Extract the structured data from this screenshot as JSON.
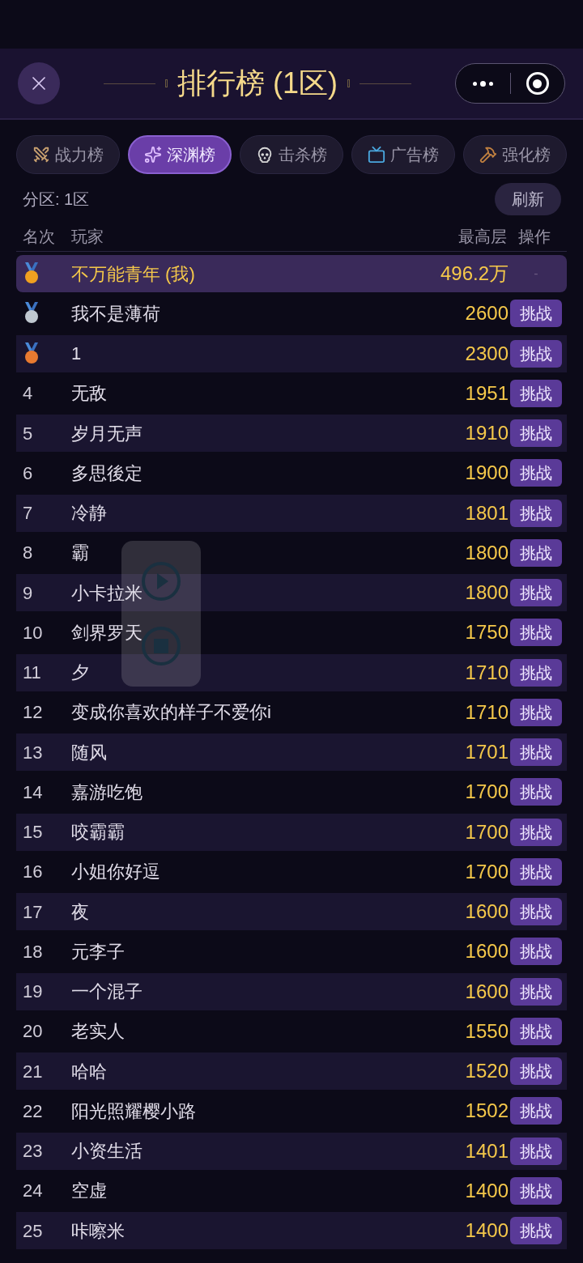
{
  "header": {
    "title": "排行榜 (1区)"
  },
  "tabs": [
    {
      "label": "战力榜",
      "selected": false
    },
    {
      "label": "深渊榜",
      "selected": true
    },
    {
      "label": "击杀榜",
      "selected": false
    },
    {
      "label": "广告榜",
      "selected": false
    },
    {
      "label": "强化榜",
      "selected": false
    }
  ],
  "zone_label": "分区: 1区",
  "refresh_button": "刷新",
  "columns": [
    "名次",
    "玩家",
    "最高层",
    "操作"
  ],
  "rows": [
    {
      "kind": "medal",
      "color": "#f0a020",
      "name": "不万能青年 (我)",
      "score": "496.2万",
      "self": true,
      "action": "-"
    },
    {
      "kind": "medal",
      "color": "#c0c8d0",
      "name": "我不是薄荷",
      "score": "2600",
      "self": false,
      "action": "挑战"
    },
    {
      "kind": "medal",
      "color": "#e87a30",
      "name": "1",
      "score": "2300",
      "self": false,
      "action": "挑战"
    },
    {
      "kind": "number",
      "rank": "4",
      "name": "无敌",
      "score": "1951",
      "self": false,
      "action": "挑战"
    },
    {
      "kind": "number",
      "rank": "5",
      "name": "岁月无声",
      "score": "1910",
      "self": false,
      "action": "挑战"
    },
    {
      "kind": "number",
      "rank": "6",
      "name": "多思後定",
      "score": "1900",
      "self": false,
      "action": "挑战"
    },
    {
      "kind": "number",
      "rank": "7",
      "name": "冷静",
      "score": "1801",
      "self": false,
      "action": "挑战"
    },
    {
      "kind": "number",
      "rank": "8",
      "name": "霸",
      "score": "1800",
      "self": false,
      "action": "挑战"
    },
    {
      "kind": "number",
      "rank": "9",
      "name": "小卡拉米",
      "score": "1800",
      "self": false,
      "action": "挑战"
    },
    {
      "kind": "number",
      "rank": "10",
      "name": "剑界罗天",
      "score": "1750",
      "self": false,
      "action": "挑战"
    },
    {
      "kind": "number",
      "rank": "11",
      "name": "夕",
      "score": "1710",
      "self": false,
      "action": "挑战"
    },
    {
      "kind": "number",
      "rank": "12",
      "name": "变成你喜欢的样子不爱你i",
      "score": "1710",
      "self": false,
      "action": "挑战"
    },
    {
      "kind": "number",
      "rank": "13",
      "name": "随风",
      "score": "1701",
      "self": false,
      "action": "挑战"
    },
    {
      "kind": "number",
      "rank": "14",
      "name": "嘉游吃饱",
      "score": "1700",
      "self": false,
      "action": "挑战"
    },
    {
      "kind": "number",
      "rank": "15",
      "name": "咬霸霸",
      "score": "1700",
      "self": false,
      "action": "挑战"
    },
    {
      "kind": "number",
      "rank": "16",
      "name": "小姐你好逗",
      "score": "1700",
      "self": false,
      "action": "挑战"
    },
    {
      "kind": "number",
      "rank": "17",
      "name": "夜",
      "score": "1600",
      "self": false,
      "action": "挑战"
    },
    {
      "kind": "number",
      "rank": "18",
      "name": "元李子",
      "score": "1600",
      "self": false,
      "action": "挑战"
    },
    {
      "kind": "number",
      "rank": "19",
      "name": "一个混子",
      "score": "1600",
      "self": false,
      "action": "挑战"
    },
    {
      "kind": "number",
      "rank": "20",
      "name": "老实人",
      "score": "1550",
      "self": false,
      "action": "挑战"
    },
    {
      "kind": "number",
      "rank": "21",
      "name": "哈哈",
      "score": "1520",
      "self": false,
      "action": "挑战"
    },
    {
      "kind": "number",
      "rank": "22",
      "name": "阳光照耀樱小路",
      "score": "1502",
      "self": false,
      "action": "挑战"
    },
    {
      "kind": "number",
      "rank": "23",
      "name": "小资生活",
      "score": "1401",
      "self": false,
      "action": "挑战"
    },
    {
      "kind": "number",
      "rank": "24",
      "name": "空虚",
      "score": "1400",
      "self": false,
      "action": "挑战"
    },
    {
      "kind": "number",
      "rank": "25",
      "name": "咔嚓米",
      "score": "1400",
      "self": false,
      "action": "挑战"
    }
  ]
}
